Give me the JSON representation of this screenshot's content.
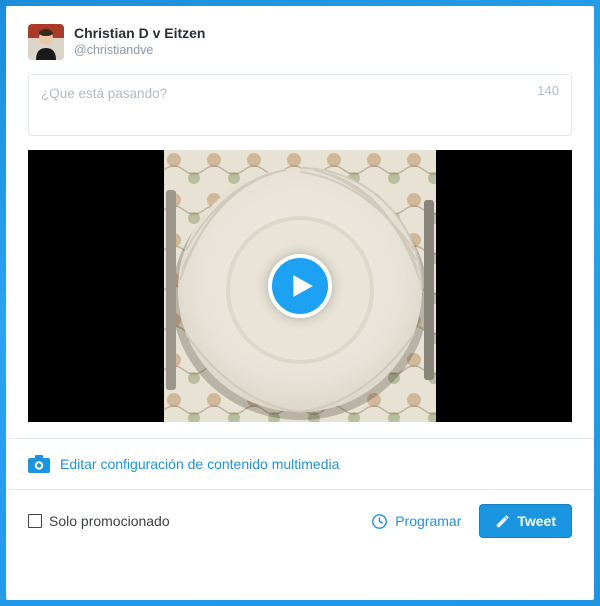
{
  "profile": {
    "name": "Christian D v Eitzen",
    "handle": "@christiandve"
  },
  "compose": {
    "placeholder": "¿Que está pasando?",
    "char_count": "140"
  },
  "media": {
    "edit_label": "Editar configuración de contenido multimedia"
  },
  "footer": {
    "promo_label": "Solo promocionado",
    "schedule_label": "Programar",
    "tweet_label": "Tweet"
  }
}
